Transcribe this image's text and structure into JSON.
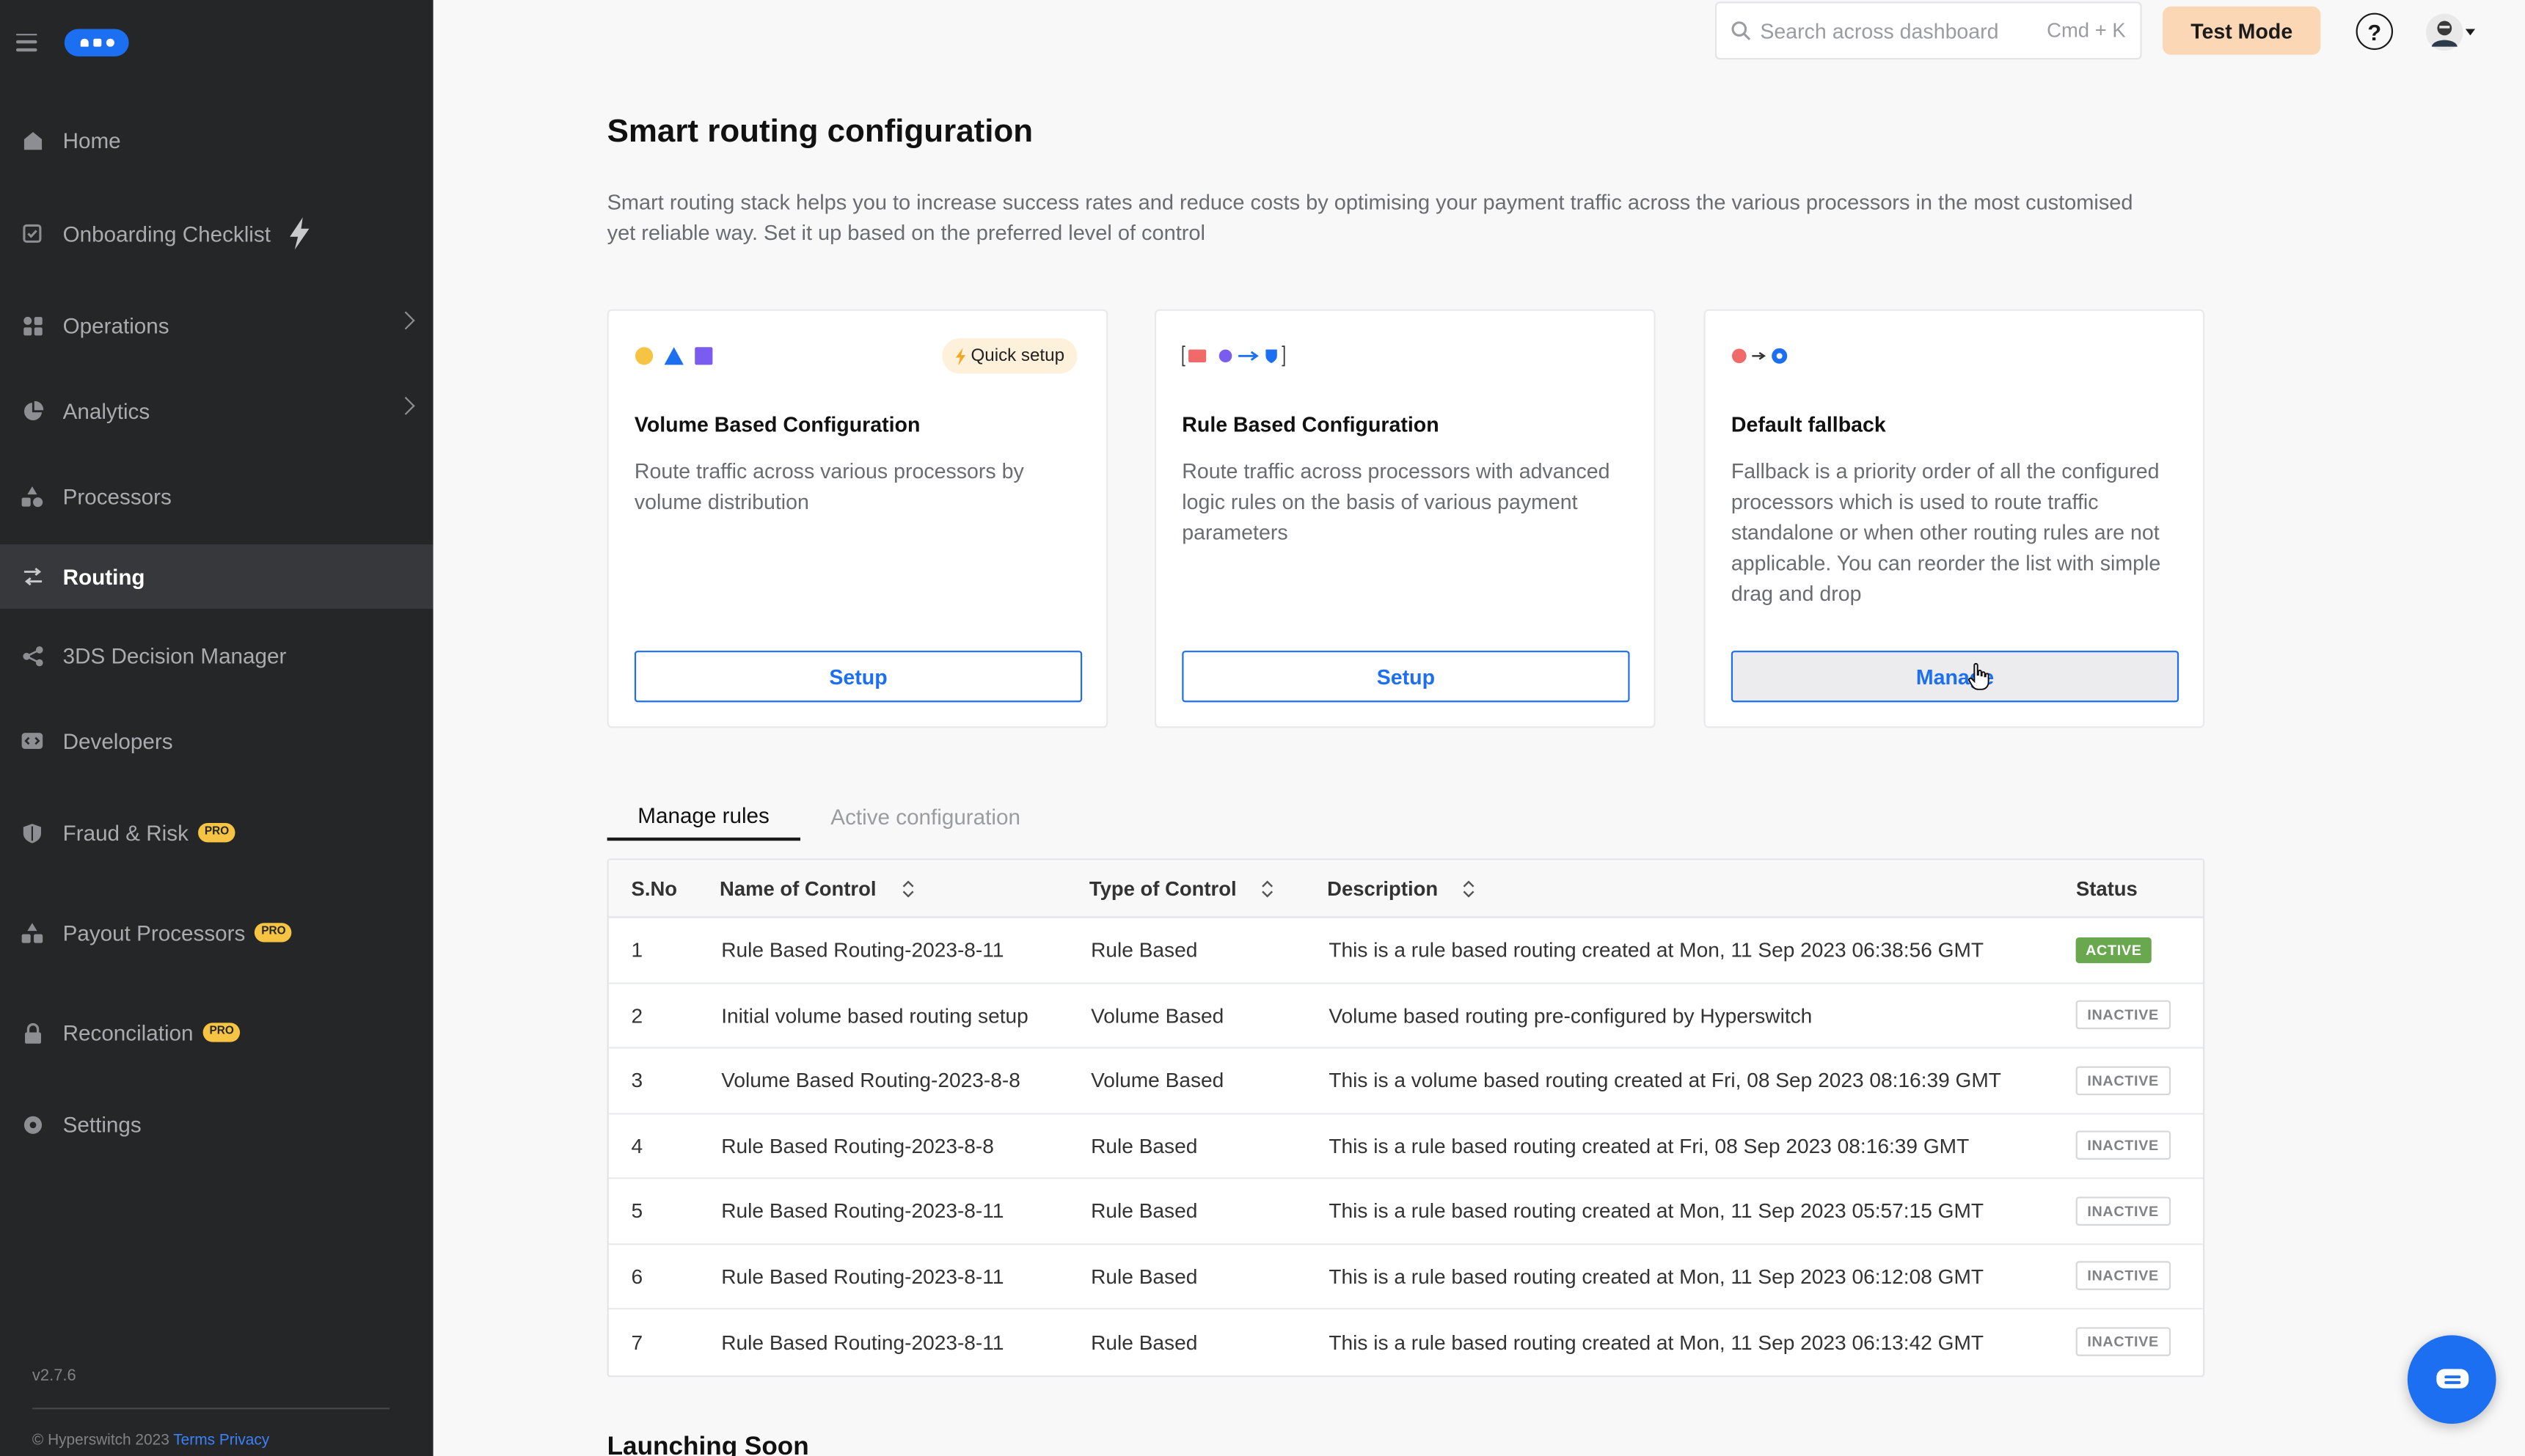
{
  "sidebar": {
    "items": [
      {
        "label": "Home",
        "icon": "home-icon"
      },
      {
        "label": "Onboarding Checklist",
        "icon": "checklist-icon"
      },
      {
        "label": "Operations",
        "icon": "operations-icon"
      },
      {
        "label": "Analytics",
        "icon": "analytics-icon"
      },
      {
        "label": "Processors",
        "icon": "processors-icon"
      },
      {
        "label": "Routing",
        "icon": "routing-icon"
      },
      {
        "label": "3DS Decision Manager",
        "icon": "share-icon"
      },
      {
        "label": "Developers",
        "icon": "developers-icon"
      },
      {
        "label": "Fraud & Risk",
        "icon": "shield-icon"
      },
      {
        "label": "Payout Processors",
        "icon": "payout-icon"
      },
      {
        "label": "Reconcilation",
        "icon": "lock-icon"
      },
      {
        "label": "Settings",
        "icon": "gear-icon"
      }
    ],
    "pro_badge": "PRO",
    "version": "v2.7.6",
    "footer": {
      "copyright": "© Hyperswitch 2023",
      "terms": "Terms",
      "privacy": "Privacy"
    }
  },
  "topbar": {
    "search_placeholder": "Search across dashboard",
    "shortcut": "Cmd + K",
    "test_mode": "Test Mode",
    "help": "?"
  },
  "page": {
    "title": "Smart routing configuration",
    "description": "Smart routing stack helps you to increase success rates and reduce costs by optimising your payment traffic across the various processors in the most customised yet reliable way. Set it up based on the preferred level of control"
  },
  "cards": [
    {
      "title": "Volume Based Configuration",
      "description": "Route traffic across various processors by volume distribution",
      "button": "Setup",
      "badge": "Quick setup"
    },
    {
      "title": "Rule Based Configuration",
      "description": "Route traffic across processors with advanced logic rules on the basis of various payment parameters",
      "button": "Setup"
    },
    {
      "title": "Default fallback",
      "description": "Fallback is a priority order of all the configured processors which is used to route traffic standalone or when other routing rules are not applicable. You can reorder the list with simple drag and drop",
      "button": "Manage"
    }
  ],
  "tabs": [
    "Manage rules",
    "Active configuration"
  ],
  "table": {
    "headers": [
      "S.No",
      "Name of Control",
      "Type of Control",
      "Description",
      "Status"
    ],
    "rows": [
      {
        "sno": "1",
        "name": "Rule Based Routing-2023-8-11",
        "type": "Rule Based",
        "description": "This is a rule based routing created at Mon, 11 Sep 2023 06:38:56 GMT",
        "status": "ACTIVE"
      },
      {
        "sno": "2",
        "name": "Initial volume based routing setup",
        "type": "Volume Based",
        "description": "Volume based routing pre-configured by Hyperswitch",
        "status": "INACTIVE"
      },
      {
        "sno": "3",
        "name": "Volume Based Routing-2023-8-8",
        "type": "Volume Based",
        "description": "This is a volume based routing created at Fri, 08 Sep 2023 08:16:39 GMT",
        "status": "INACTIVE"
      },
      {
        "sno": "4",
        "name": "Rule Based Routing-2023-8-8",
        "type": "Rule Based",
        "description": "This is a rule based routing created at Fri, 08 Sep 2023 08:16:39 GMT",
        "status": "INACTIVE"
      },
      {
        "sno": "5",
        "name": "Rule Based Routing-2023-8-11",
        "type": "Rule Based",
        "description": "This is a rule based routing created at Mon, 11 Sep 2023 05:57:15 GMT",
        "status": "INACTIVE"
      },
      {
        "sno": "6",
        "name": "Rule Based Routing-2023-8-11",
        "type": "Rule Based",
        "description": "This is a rule based routing created at Mon, 11 Sep 2023 06:12:08 GMT",
        "status": "INACTIVE"
      },
      {
        "sno": "7",
        "name": "Rule Based Routing-2023-8-11",
        "type": "Rule Based",
        "description": "This is a rule based routing created at Mon, 11 Sep 2023 06:13:42 GMT",
        "status": "INACTIVE"
      }
    ]
  },
  "launching_soon": "Launching Soon",
  "colors": {
    "accent": "#1d6ff2",
    "sidebar_bg": "#242628",
    "active_badge": "#6aa84f",
    "test_mode_bg": "#fbd7b6"
  }
}
